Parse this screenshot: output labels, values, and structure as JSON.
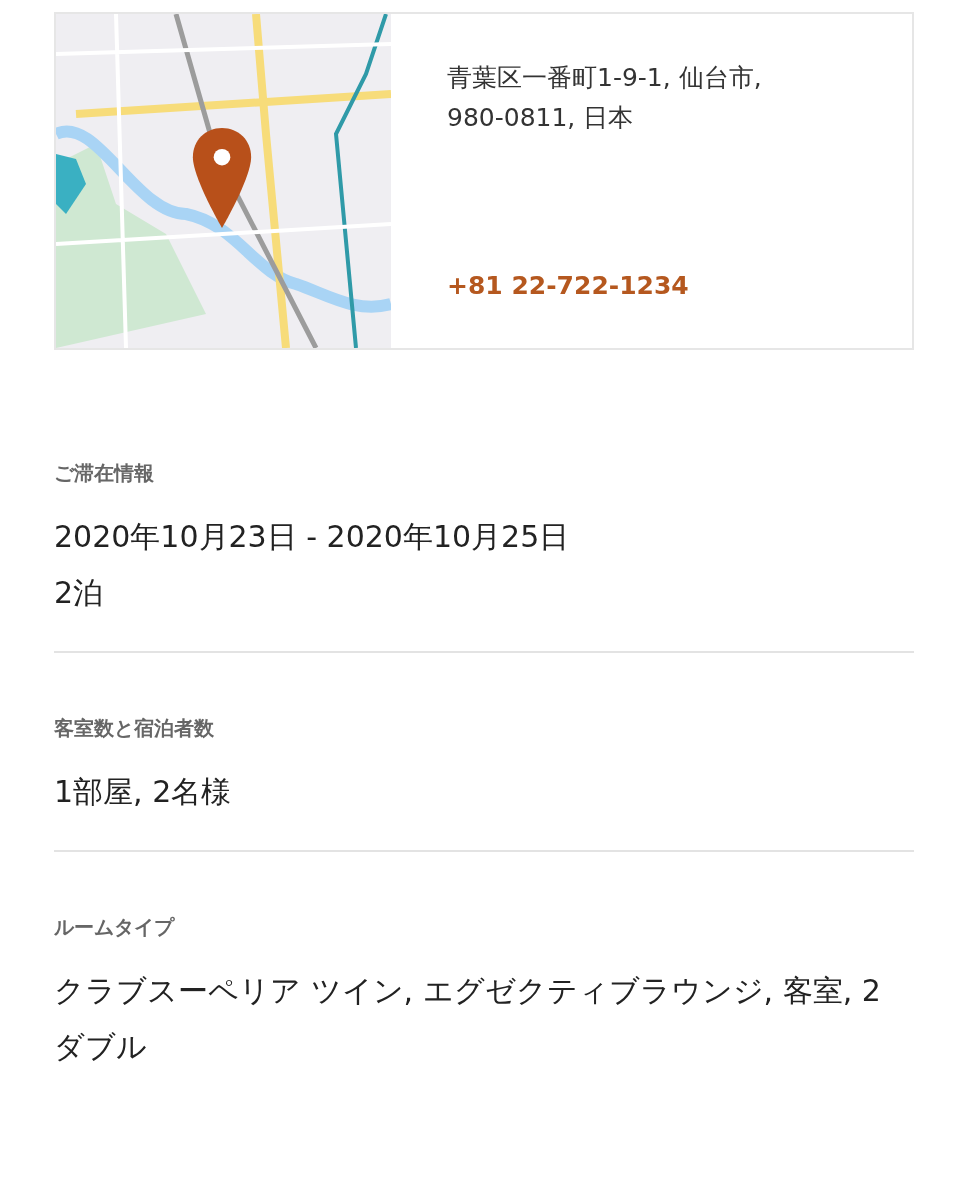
{
  "location": {
    "map": {
      "kind": "picture"
    },
    "address_lines": [
      "青葉区一番町1-9-1, 仙台市,",
      "980-0811, 日本"
    ],
    "phone": "+81 22-722-1234"
  },
  "sections": [
    {
      "label": "ご滞在情報",
      "lines": [
        "2020年10月23日 - 2020年10月25日",
        "2泊"
      ]
    },
    {
      "label": "客室数と宿泊者数",
      "lines": [
        "1部屋, 2名様"
      ]
    },
    {
      "label": "ルームタイプ",
      "lines": [
        "クラブスーペリア ツイン, エグゼクティブラウンジ, 客室, 2 ダブル"
      ]
    }
  ]
}
